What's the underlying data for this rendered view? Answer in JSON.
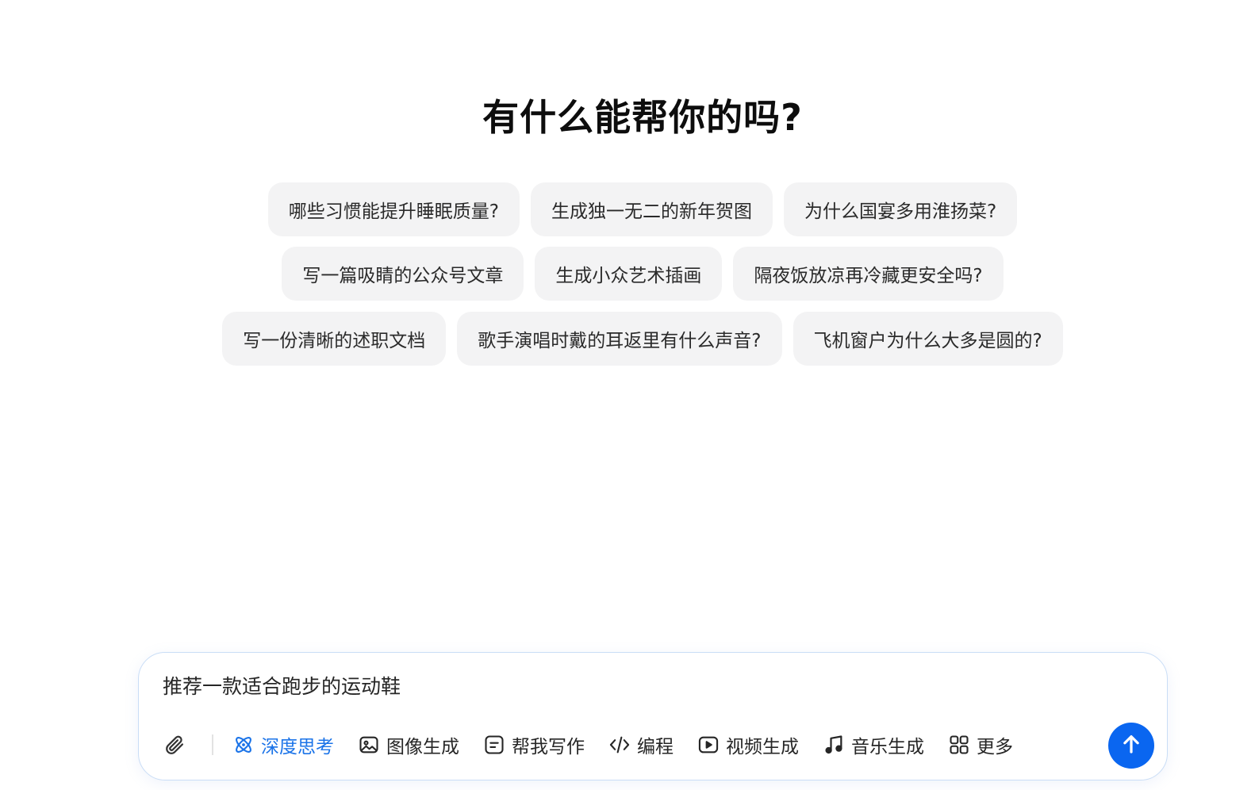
{
  "headline": "有什么能帮你的吗?",
  "suggestions": {
    "row1": [
      "哪些习惯能提升睡眠质量?",
      "生成独一无二的新年贺图",
      "为什么国宴多用淮扬菜?"
    ],
    "row2": [
      "写一篇吸睛的公众号文章",
      "生成小众艺术插画",
      "隔夜饭放凉再冷藏更安全吗?"
    ],
    "row3": [
      "写一份清晰的述职文档",
      "歌手演唱时戴的耳返里有什么声音?",
      "飞机窗户为什么大多是圆的?"
    ]
  },
  "composer": {
    "input_value": "推荐一款适合跑步的运动鞋",
    "tools": [
      {
        "label": "深度思考",
        "icon": "atom-icon",
        "active": true
      },
      {
        "label": "图像生成",
        "icon": "image-icon",
        "active": false
      },
      {
        "label": "帮我写作",
        "icon": "document-icon",
        "active": false
      },
      {
        "label": "编程",
        "icon": "code-icon",
        "active": false
      },
      {
        "label": "视频生成",
        "icon": "play-icon",
        "active": false
      },
      {
        "label": "音乐生成",
        "icon": "music-note-icon",
        "active": false
      },
      {
        "label": "更多",
        "icon": "grid-icon",
        "active": false
      }
    ],
    "attach_icon": "paperclip-icon",
    "send_icon": "arrow-up-icon"
  },
  "colors": {
    "accent": "#1a73e8",
    "send_button": "#0a66f0",
    "chip_bg": "#f3f3f4",
    "composer_border": "#c9ddf6"
  }
}
